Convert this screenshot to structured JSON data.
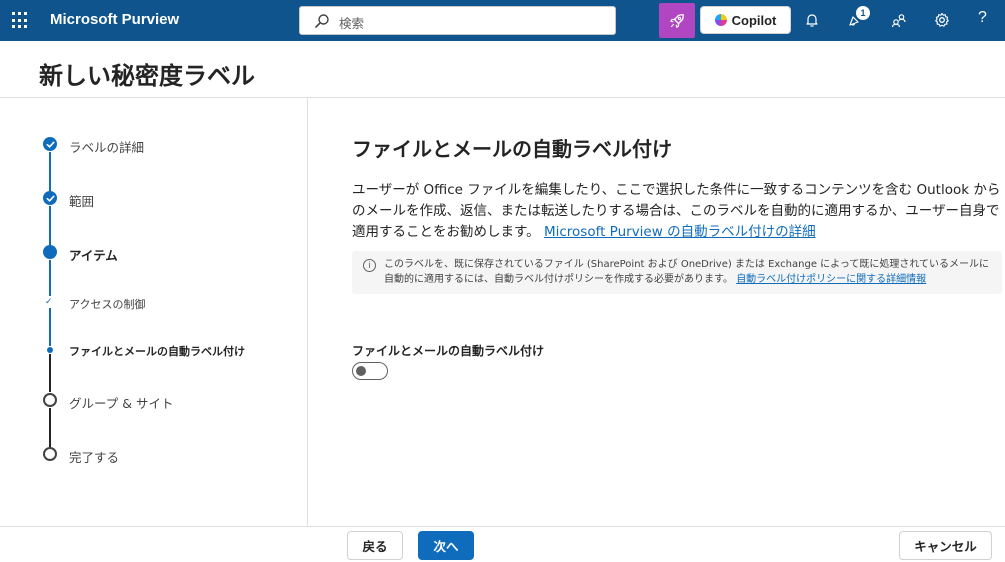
{
  "app": {
    "title": "Microsoft Purview"
  },
  "search": {
    "placeholder": "検索"
  },
  "header": {
    "copilot_label": "Copilot",
    "notification_count": "1",
    "help_label": "?"
  },
  "page": {
    "title": "新しい秘密度ラベル"
  },
  "stepper": {
    "steps": [
      {
        "label": "ラベルの詳細",
        "state": "complete"
      },
      {
        "label": "範囲",
        "state": "complete"
      },
      {
        "label": "アイテム",
        "state": "current"
      },
      {
        "label": "アクセスの制御",
        "state": "complete-substep"
      },
      {
        "label": "ファイルとメールの自動ラベル付け",
        "state": "current-substep"
      },
      {
        "label": "グループ & サイト",
        "state": "not-started"
      },
      {
        "label": "完了する",
        "state": "not-started"
      }
    ]
  },
  "main": {
    "title": "ファイルとメールの自動ラベル付け",
    "description": "ユーザーが Office ファイルを編集したり、ここで選択した条件に一致するコンテンツを含む Outlook からのメールを作成、返信、または転送したりする場合は、このラベルを自動的に適用するか、ユーザー自身で適用することをお勧めします。",
    "description_link": "Microsoft Purview の自動ラベル付けの詳細",
    "info_text": "このラベルを、既に保存されているファイル (SharePoint および OneDrive) または Exchange によって既に処理されているメールに自動的に適用するには、自動ラベル付けポリシーを作成する必要があります。",
    "info_link": "自動ラベル付けポリシーに関する詳細情報",
    "toggle_label": "ファイルとメールの自動ラベル付け",
    "toggle_on": false
  },
  "footer": {
    "back_label": "戻る",
    "next_label": "次へ",
    "cancel_label": "キャンセル"
  },
  "colors": {
    "brand_bar": "#0f548c",
    "accent": "#0f6cbd",
    "rocket_button": "#b146c2"
  }
}
